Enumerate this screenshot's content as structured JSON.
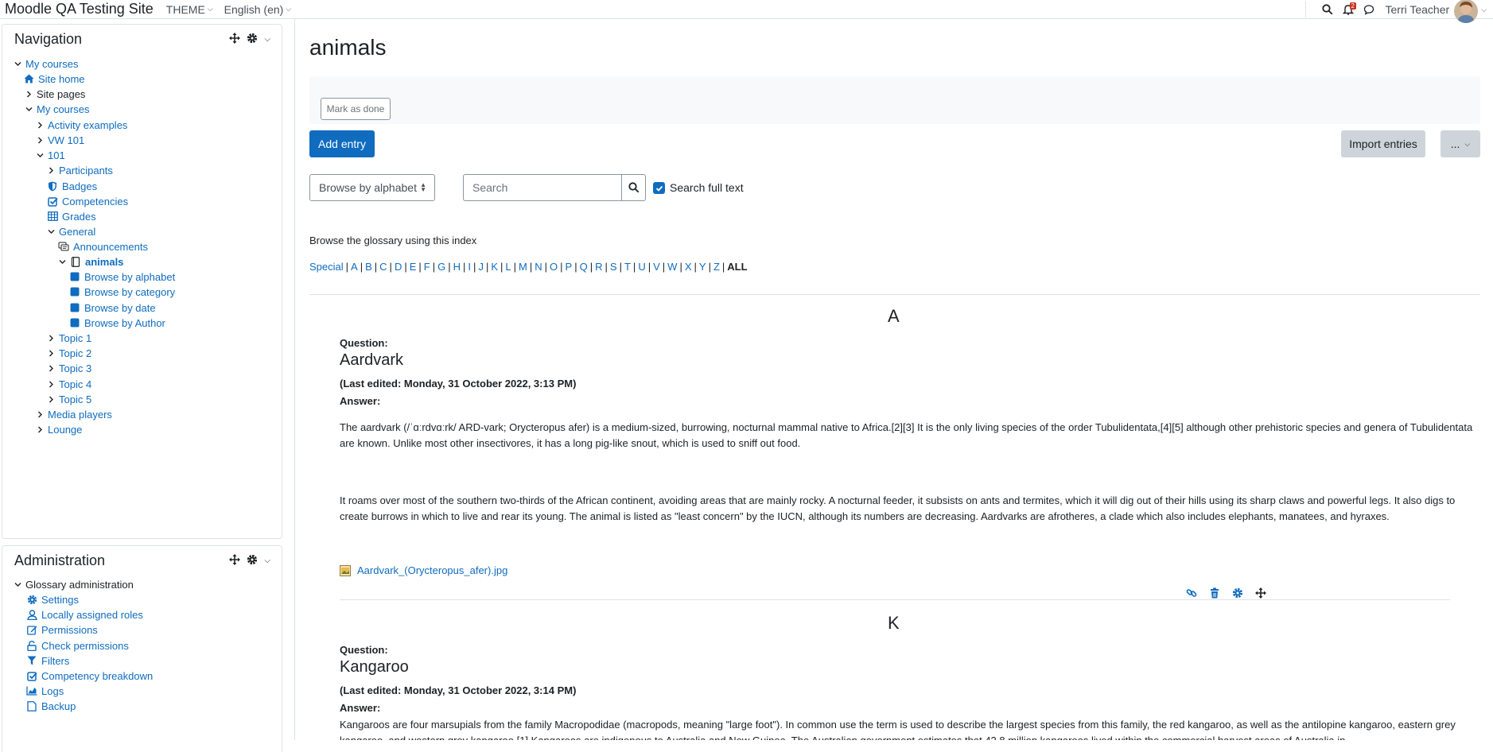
{
  "navbar": {
    "site_name": "Moodle QA Testing Site",
    "theme_menu": "THEME",
    "language_menu": "English (en)",
    "notification_count": "2",
    "user_name": "Terri Teacher"
  },
  "navigation_block": {
    "title": "Navigation",
    "items": [
      {
        "label": "My courses",
        "chevron": "down",
        "icon": ""
      },
      {
        "label": "Site home",
        "chevron": "",
        "icon": "home-icon"
      },
      {
        "label": "Site pages",
        "chevron": "right",
        "icon": ""
      },
      {
        "label": "My courses",
        "chevron": "down",
        "icon": ""
      },
      {
        "label": "Activity examples",
        "chevron": "right",
        "icon": ""
      },
      {
        "label": "VW 101",
        "chevron": "right",
        "icon": ""
      },
      {
        "label": "101",
        "chevron": "down",
        "icon": ""
      },
      {
        "label": "Participants",
        "chevron": "right",
        "icon": ""
      },
      {
        "label": "Badges",
        "chevron": "",
        "icon": "shield-icon"
      },
      {
        "label": "Competencies",
        "chevron": "",
        "icon": "checkbox-icon"
      },
      {
        "label": "Grades",
        "chevron": "",
        "icon": "table-icon"
      },
      {
        "label": "General",
        "chevron": "down",
        "icon": ""
      },
      {
        "label": "Announcements",
        "chevron": "",
        "icon": "forum-icon"
      },
      {
        "label": "animals",
        "chevron": "down",
        "icon": "glossary-icon"
      },
      {
        "label": "Browse by alphabet",
        "chevron": "",
        "icon": "square-icon"
      },
      {
        "label": "Browse by category",
        "chevron": "",
        "icon": "square-icon"
      },
      {
        "label": "Browse by date",
        "chevron": "",
        "icon": "square-icon"
      },
      {
        "label": "Browse by Author",
        "chevron": "",
        "icon": "square-icon"
      },
      {
        "label": "Topic 1",
        "chevron": "right",
        "icon": ""
      },
      {
        "label": "Topic 2",
        "chevron": "right",
        "icon": ""
      },
      {
        "label": "Topic 3",
        "chevron": "right",
        "icon": ""
      },
      {
        "label": "Topic 4",
        "chevron": "right",
        "icon": ""
      },
      {
        "label": "Topic 5",
        "chevron": "right",
        "icon": ""
      },
      {
        "label": "Media players",
        "chevron": "right",
        "icon": ""
      },
      {
        "label": "Lounge",
        "chevron": "right",
        "icon": ""
      }
    ]
  },
  "administration_block": {
    "title": "Administration",
    "items": [
      {
        "label": "Glossary administration",
        "chevron": "down",
        "icon": ""
      },
      {
        "label": "Settings",
        "chevron": "",
        "icon": "gear-icon"
      },
      {
        "label": "Locally assigned roles",
        "chevron": "",
        "icon": "user-icon"
      },
      {
        "label": "Permissions",
        "chevron": "",
        "icon": "edit-icon"
      },
      {
        "label": "Check permissions",
        "chevron": "",
        "icon": "unlock-icon"
      },
      {
        "label": "Filters",
        "chevron": "",
        "icon": "filter-icon"
      },
      {
        "label": "Competency breakdown",
        "chevron": "",
        "icon": "checkbox-icon"
      },
      {
        "label": "Logs",
        "chevron": "",
        "icon": "chart-icon"
      },
      {
        "label": "Backup",
        "chevron": "",
        "icon": "file-icon"
      }
    ]
  },
  "main": {
    "title": "animals",
    "mark_done": "Mark as done",
    "add_entry": "Add entry",
    "import_entries": "Import entries",
    "more_menu": "...",
    "browse_select": "Browse by alphabet",
    "search_placeholder": "Search",
    "search_full_text": "Search full text",
    "browse_index_text": "Browse the glossary using this index",
    "alphabet": [
      "Special",
      "A",
      "B",
      "C",
      "D",
      "E",
      "F",
      "G",
      "H",
      "I",
      "J",
      "K",
      "L",
      "M",
      "N",
      "O",
      "P",
      "Q",
      "R",
      "S",
      "T",
      "U",
      "V",
      "W",
      "X",
      "Y",
      "Z"
    ],
    "alphabet_current": "ALL"
  },
  "entries": [
    {
      "letter": "A",
      "question_label": "Question:",
      "concept": "Aardvark",
      "last_edited": "(Last edited: Monday, 31 October 2022, 3:13 PM)",
      "answer_label": "Answer:",
      "paragraphs": [
        "The aardvark (/ˈɑːrdvɑːrk/ ARD-vark; Orycteropus afer) is a medium-sized, burrowing, nocturnal mammal native to Africa.[2][3] It is the only living species of the order Tubulidentata,[4][5] although other prehistoric species and genera of Tubulidentata are known. Unlike most other insectivores, it has a long pig-like snout, which is used to sniff out food.",
        "It roams over most of the southern two-thirds of the African continent, avoiding areas that are mainly rocky. A nocturnal feeder, it subsists on ants and termites, which it will dig out of their hills using its sharp claws and powerful legs. It also digs to create burrows in which to live and rear its young. The animal is listed as \"least concern\" by the IUCN, although its numbers are decreasing. Aardvarks are afrotheres, a clade which also includes elephants, manatees, and hyraxes."
      ],
      "attachment": "Aardvark_(Orycteropus_afer).jpg"
    },
    {
      "letter": "K",
      "question_label": "Question:",
      "concept": "Kangaroo",
      "last_edited": "(Last edited: Monday, 31 October 2022, 3:14 PM)",
      "answer_label": "Answer:",
      "paragraphs": [
        "Kangaroos are four marsupials from the family Macropodidae (macropods, meaning \"large foot\"). In common use the term is used to describe the largest species from this family, the red kangaroo, as well as the antilopine kangaroo, eastern grey kangaroo, and western grey kangaroo.[1] Kangaroos are indigenous to Australia and New Guinea. The Australian government estimates that 42.8 million kangaroos lived within the commercial harvest areas of Australia in"
      ]
    }
  ],
  "colors": {
    "link": "#0f6cbf",
    "text": "#1d2125",
    "border": "#dee2e6",
    "primary_button": "#0f6cbf",
    "secondary_button": "#ced4da",
    "badge": "#ca3120"
  }
}
